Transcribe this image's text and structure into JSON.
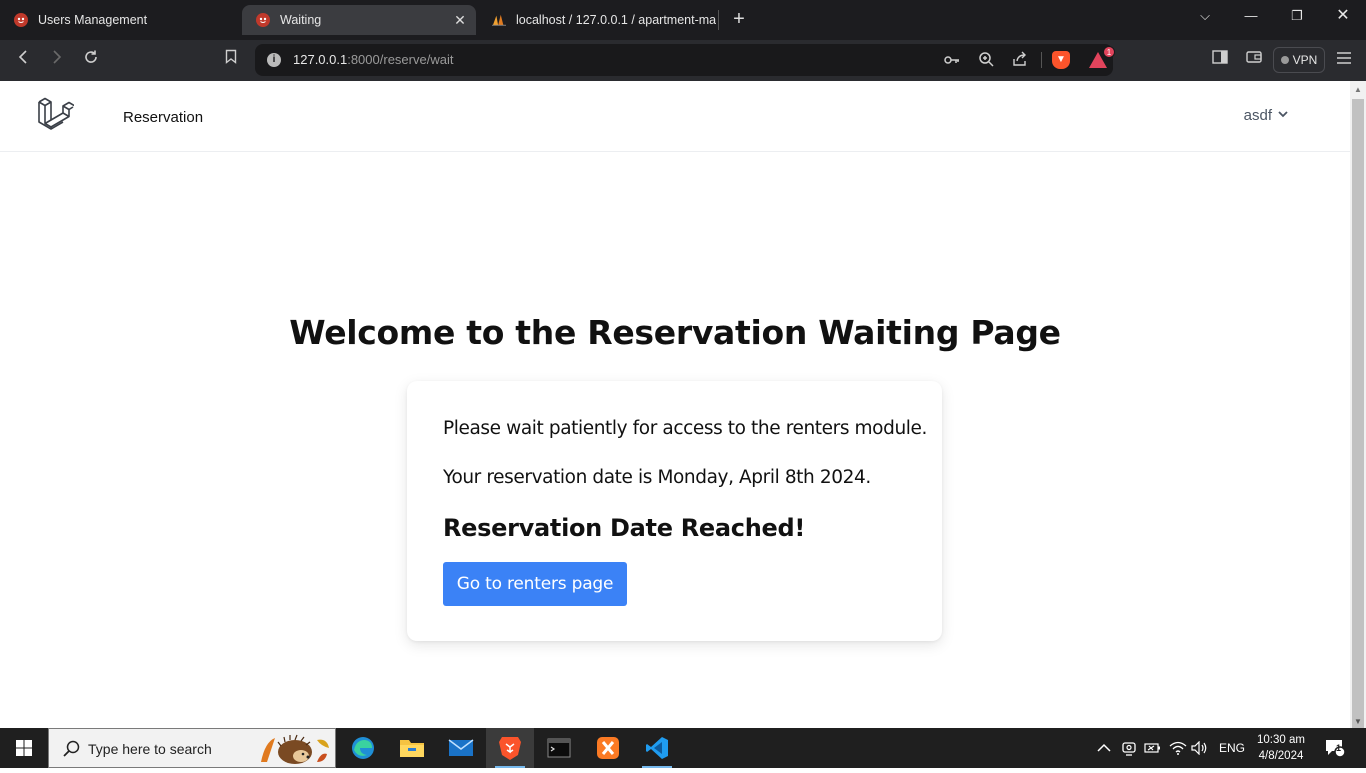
{
  "browser": {
    "tabs": [
      {
        "label": "Users Management"
      },
      {
        "label": "Waiting"
      },
      {
        "label": "localhost / 127.0.0.1 / apartment-ma"
      }
    ],
    "url_host": "127.0.0.1",
    "url_path": ":8000/reserve/wait",
    "vpn_label": "VPN",
    "rewards_badge": "1"
  },
  "app": {
    "brand": "Reservation",
    "user_name": "asdf"
  },
  "main": {
    "heading": "Welcome to the Reservation Waiting Page",
    "wait_message": "Please wait patiently for access to the renters module.",
    "date_prefix": "Your reservation date is",
    "reservation_date": "Monday, April 8th 2024",
    "date_suffix": ".",
    "status": "Reservation Date Reached!",
    "button_label": "Go to renters page",
    "button_color": "#3b82f6"
  },
  "taskbar": {
    "search_placeholder": "Type here to search",
    "language": "ENG",
    "time": "10:30 am",
    "date": "4/8/2024",
    "notification_count": "1"
  }
}
